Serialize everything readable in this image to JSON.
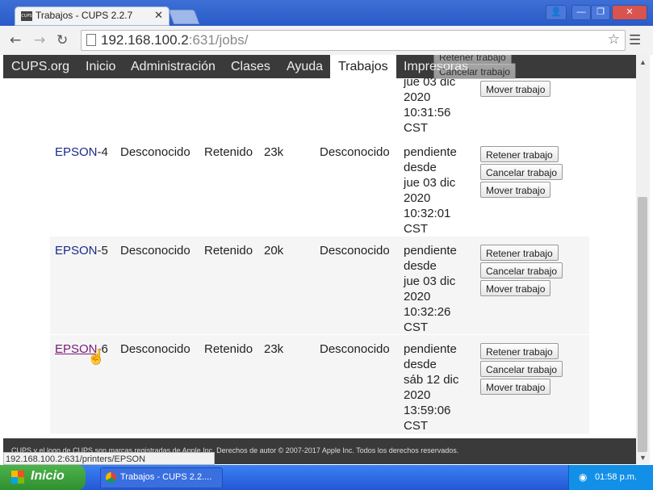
{
  "browser": {
    "tab_title": "Trabajos - CUPS 2.2.7",
    "tab_close": "✕",
    "favicon_text": "CUPS",
    "url_host": "192.168.100.2",
    "url_path": ":631/jobs/",
    "status_url": "192.168.100.2:631/printers/EPSON",
    "window_controls": [
      "👤",
      "—",
      "❐",
      "✕"
    ]
  },
  "nav": {
    "items": [
      "CUPS.org",
      "Inicio",
      "Administración",
      "Clases",
      "Ayuda",
      "Trabajos",
      "Impresoras"
    ],
    "active": "Trabajos"
  },
  "partial_row": {
    "state_lines": "jue 03 dic\n2020\n10:31:56\nCST",
    "move_label": "Mover trabajo",
    "ghost_buttons": [
      "Retener trabajo",
      "Cancelar trabajo"
    ]
  },
  "jobs": [
    {
      "printer": "EPSON",
      "job_suffix": "-4",
      "name": "Desconocido",
      "user": "Retenido",
      "size": "23k",
      "pages": "Desconocido",
      "state": "pendiente\ndesde\njue 03 dic\n2020\n10:32:01\nCST"
    },
    {
      "printer": "EPSON",
      "job_suffix": "-5",
      "name": "Desconocido",
      "user": "Retenido",
      "size": "20k",
      "pages": "Desconocido",
      "state": "pendiente\ndesde\njue 03 dic\n2020\n10:32:26\nCST"
    },
    {
      "printer": "EPSON",
      "job_suffix": "-6",
      "name": "Desconocido",
      "user": "Retenido",
      "size": "23k",
      "pages": "Desconocido",
      "state": "pendiente\ndesde\nsáb 12 dic\n2020\n13:59:06\nCST"
    }
  ],
  "buttons": {
    "hold": "Retener trabajo",
    "cancel": "Cancelar trabajo",
    "move": "Mover trabajo"
  },
  "footer": {
    "text": "CUPS y el logo de CUPS son marcas registradas de Apple Inc. Derechos de autor © 2007-2017 Apple Inc. Todos los derechos reservados."
  },
  "taskbar": {
    "start_label": "Inicio",
    "task_label": "Trabajos - CUPS 2.2....",
    "clock": "01:58 p.m."
  }
}
